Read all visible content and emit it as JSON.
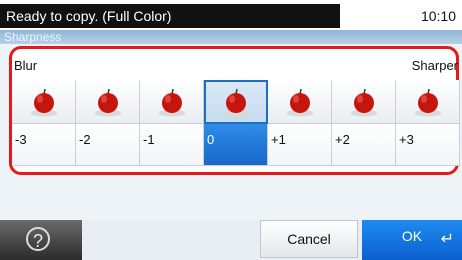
{
  "status": {
    "message": "Ready to copy. (Full Color)",
    "time": "10:10"
  },
  "screen": {
    "title": "Sharpness"
  },
  "scale": {
    "left_label": "Blur",
    "right_label": "Sharper"
  },
  "options": [
    {
      "label": "-3",
      "selected": false
    },
    {
      "label": "-2",
      "selected": false
    },
    {
      "label": "-1",
      "selected": false
    },
    {
      "label": "0",
      "selected": true
    },
    {
      "label": "+1",
      "selected": false
    },
    {
      "label": "+2",
      "selected": false
    },
    {
      "label": "+3",
      "selected": false
    }
  ],
  "buttons": {
    "help": "?",
    "cancel": "Cancel",
    "ok": "OK",
    "ok_icon": "↵"
  },
  "colors": {
    "accent": "#1867c8",
    "highlight_frame": "#e6191c",
    "apple": "#c8140f"
  }
}
